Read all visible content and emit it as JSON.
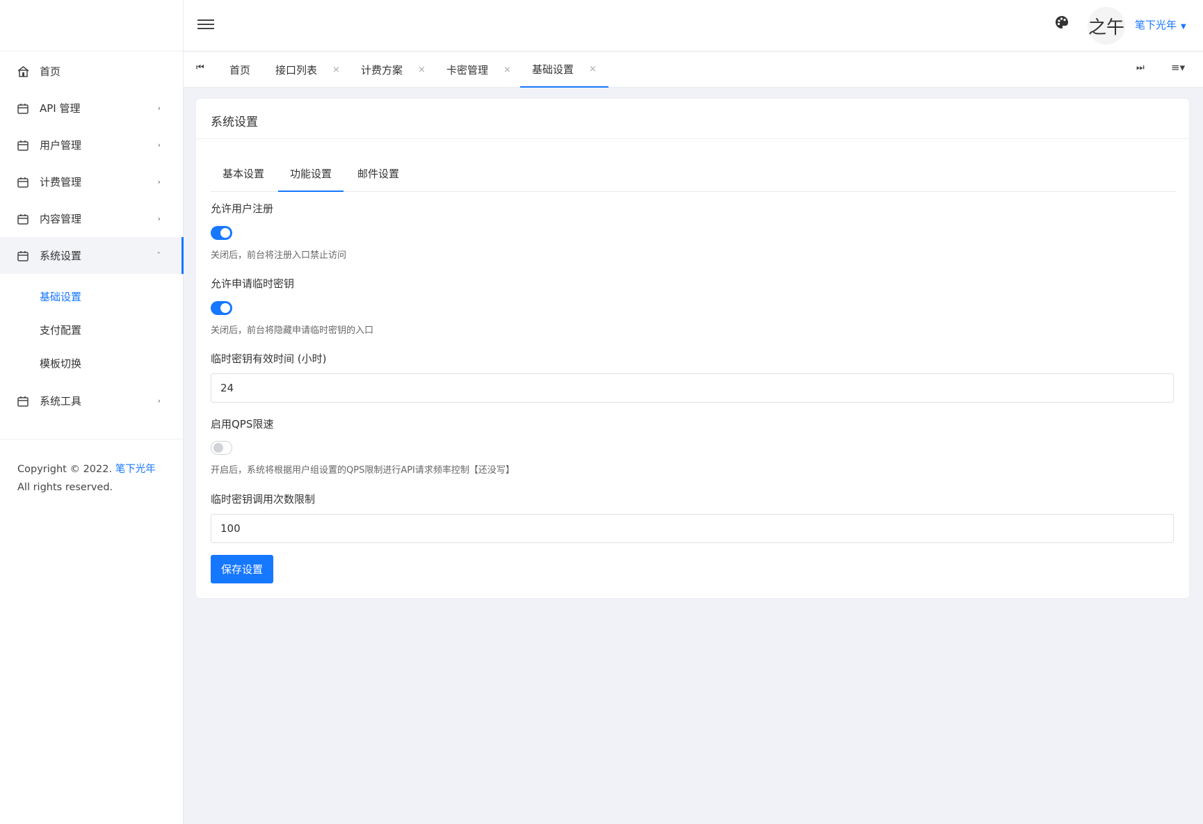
{
  "sidebar": {
    "items": [
      {
        "label": "首页",
        "icon": "home-icon"
      },
      {
        "label": "API 管理",
        "icon": "calendar-icon"
      },
      {
        "label": "用户管理",
        "icon": "calendar-icon"
      },
      {
        "label": "计费管理",
        "icon": "calendar-icon"
      },
      {
        "label": "内容管理",
        "icon": "calendar-icon"
      },
      {
        "label": "系统设置",
        "icon": "calendar-icon"
      },
      {
        "label": "系统工具",
        "icon": "calendar-icon"
      }
    ],
    "submenu": [
      "基础设置",
      "支付配置",
      "模板切换"
    ],
    "copyright_prefix": "Copyright © 2022.",
    "copyright_link": "笔下光年",
    "copyright_suffix": "All rights reserved."
  },
  "header": {
    "avatar_text": "之午",
    "username": "笔下光年"
  },
  "page_tabs": [
    "首页",
    "接口列表",
    "计费方案",
    "卡密管理",
    "基础设置"
  ],
  "card": {
    "title": "系统设置",
    "tabs": [
      "基本设置",
      "功能设置",
      "邮件设置"
    ],
    "allow_register_label": "允许用户注册",
    "allow_register_hint": "关闭后，前台将注册入口禁止访问",
    "allow_register": true,
    "allow_tempkey_label": "允许申请临时密钥",
    "allow_tempkey_hint": "关闭后，前台将隐藏申请临时密钥的入口",
    "allow_tempkey": true,
    "tempkey_hours_label": "临时密钥有效时间 (小时)",
    "tempkey_hours_value": "24",
    "qps_label": "启用QPS限速",
    "qps_hint": "开启后，系统将根据用户组设置的QPS限制进行API请求频率控制【还没写】",
    "qps_enabled": false,
    "tempkey_calls_label": "临时密钥调用次数限制",
    "tempkey_calls_value": "100",
    "save_label": "保存设置"
  },
  "colors": {
    "accent": "#1677ff",
    "background": "#f0f2f7"
  }
}
